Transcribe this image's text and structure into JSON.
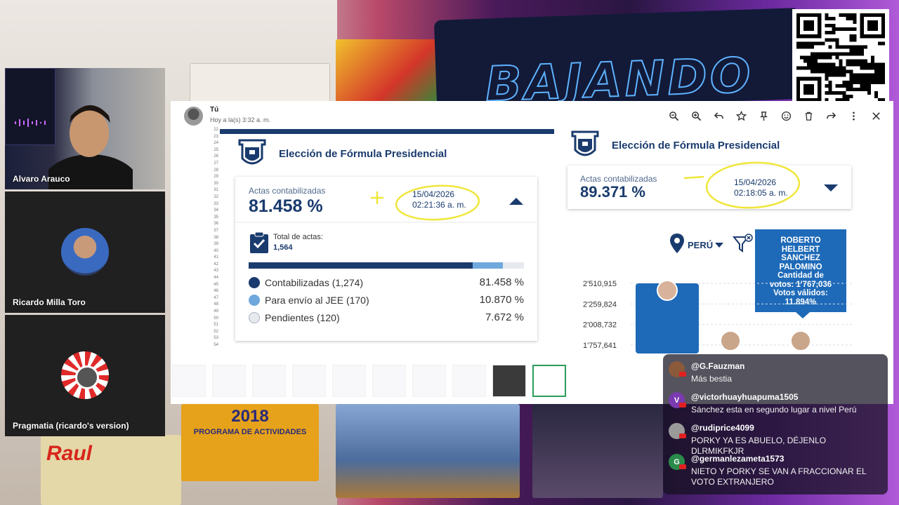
{
  "participants": [
    {
      "name": "Alvaro Arauco"
    },
    {
      "name": "Ricardo Milla Toro"
    },
    {
      "name": "Pragmatia (ricardo's version)"
    }
  ],
  "viewer": {
    "sender": "Tú",
    "time": "Hoy a la(s) 3:32 a. m.",
    "toolbar": [
      "zoom-out",
      "zoom-in",
      "reply",
      "star",
      "pin",
      "emoji",
      "delete",
      "forward",
      "more",
      "close"
    ]
  },
  "left_doc": {
    "title": "Elección de Fórmula Presidencial",
    "actas_label": "Actas contabilizadas",
    "actas_value": "81.458 %",
    "date": "15/04/2026",
    "time": "02:21:36 a. m.",
    "total_label": "Total de actas:",
    "total_value": "1,564",
    "progress": {
      "contabilizadas": 81.458,
      "envio_jee": 10.87
    },
    "legend": [
      {
        "label": "Contabilizadas (1,274)",
        "value": "81.458 %",
        "color": "#1a3b6e"
      },
      {
        "label": "Para envío al JEE (170)",
        "value": "10.870 %",
        "color": "#6fa8dc"
      },
      {
        "label": "Pendientes (120)",
        "value": "7.672 %",
        "color": "#e6e9ee"
      }
    ],
    "row_numbers": [
      "22",
      "23",
      "24",
      "25",
      "26",
      "27",
      "28",
      "29",
      "30",
      "31",
      "32",
      "33",
      "34",
      "35",
      "36",
      "37",
      "38",
      "39",
      "40",
      "41",
      "42",
      "43",
      "44",
      "45",
      "46",
      "47",
      "48",
      "49",
      "50",
      "51",
      "52",
      "53",
      "54"
    ]
  },
  "right_doc": {
    "title": "Elección de Fórmula Presidencial",
    "actas_label": "Actas contabilizadas",
    "actas_value": "89.371 %",
    "date": "15/04/2026",
    "time": "02:18:05 a. m.",
    "region": "PERÚ",
    "tooltip": [
      "ROBERTO",
      "HELBERT",
      "SANCHEZ",
      "PALOMINO",
      "Cantidad de",
      "votos: 1'767,036",
      "Votos válidos:",
      "11.894%"
    ],
    "y_ticks": [
      "2'510,915",
      "2'259,824",
      "2'008,732",
      "1'757,641"
    ]
  },
  "chart_data": {
    "type": "bar",
    "categories": [
      "",
      "",
      ""
    ],
    "values": [
      2510915,
      1760000,
      1767036
    ],
    "ylim": [
      1757641,
      2510915
    ],
    "y_ticks": [
      "2'510,915",
      "2'259,824",
      "2'008,732",
      "1'757,641"
    ]
  },
  "filmstrip": {
    "count": 10,
    "active_index": 9
  },
  "chat": [
    {
      "user": "@G.Fauzman",
      "text": "Más bestia",
      "avatar": "",
      "color": "#8a5a3a"
    },
    {
      "user": "@victorhuayhuapuma1505",
      "text": "Sánchez esta en segundo lugar a nivel Perú",
      "avatar": "V",
      "color": "#7a3ab0"
    },
    {
      "user": "@rudiprice4099",
      "text": "PORKY YA ES ABUELO, DÉJENLO DLRMIKFKJR",
      "avatar": "",
      "color": "#9a9a9a"
    },
    {
      "user": "@germanlezameta1573",
      "text": "NIETO Y PORKY SE VAN A FRACCIONAR EL VOTO EXTRANJERO",
      "avatar": "G",
      "color": "#2a8a4a"
    }
  ],
  "colors": {
    "brand": "#1a3b6e",
    "light_blue": "#6fa8dc",
    "tooltip": "#1e6ab8",
    "highlight": "#f0e63a"
  }
}
